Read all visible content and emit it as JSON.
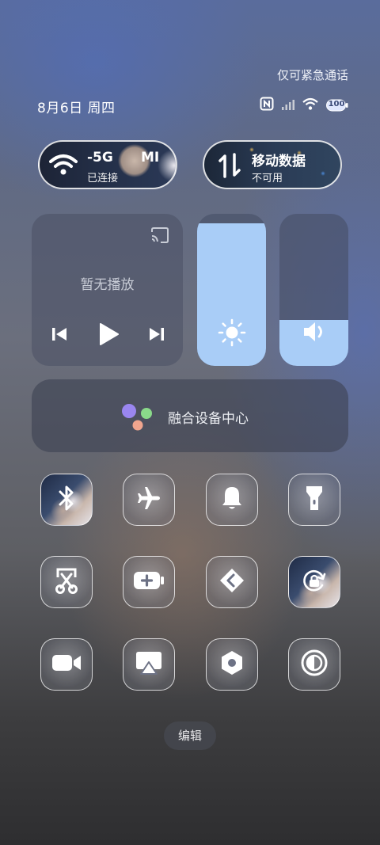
{
  "status": {
    "emergency_text": "仅可紧急通话",
    "date": "8月6日 周四",
    "battery": "100",
    "icons": [
      "nfc-icon",
      "signal-icon",
      "wifi-icon",
      "battery-icon"
    ]
  },
  "wifi_card": {
    "title": "-5G",
    "title_extra": "MI",
    "subtitle": "已连接",
    "icon": "wifi-icon"
  },
  "data_card": {
    "title": "移动数据",
    "subtitle": "不可用",
    "icon": "mobile-data-icon"
  },
  "media": {
    "status": "暂无播放",
    "icons": [
      "cast-icon",
      "previous-icon",
      "play-icon",
      "next-icon"
    ]
  },
  "sliders": {
    "brightness": {
      "level": 0.94,
      "icon": "sun-icon"
    },
    "volume": {
      "level": 0.3,
      "icon": "speaker-icon"
    }
  },
  "device_center": {
    "label": "融合设备中心"
  },
  "toggles": [
    "bluetooth",
    "airplane-mode",
    "notification-bell",
    "flashlight",
    "screenshot",
    "battery-saver",
    "share",
    "screen-lock",
    "screen-recorder",
    "screen-cast",
    "settings",
    "dark-mode"
  ],
  "edit_label": "编辑",
  "colors": {
    "slider_fill": "#a9cdf7",
    "accent_purple": "#9a86f0",
    "accent_green": "#8ad98a",
    "accent_peach": "#f0a58e"
  }
}
